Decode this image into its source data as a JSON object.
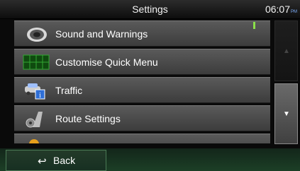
{
  "header": {
    "title": "Settings",
    "time": "06:07",
    "ampm": "PM"
  },
  "menu": {
    "items": [
      {
        "label": "Sound and Warnings",
        "icon": "speaker-icon"
      },
      {
        "label": "Customise Quick Menu",
        "icon": "grid-icon"
      },
      {
        "label": "Traffic",
        "icon": "traffic-info-icon"
      },
      {
        "label": "Route Settings",
        "icon": "route-settings-icon"
      }
    ]
  },
  "scroll": {
    "up": "▲",
    "down": "▼"
  },
  "footer": {
    "back_label": "Back",
    "back_icon": "↩"
  },
  "colors": {
    "accent": "#8be04a",
    "item_bg": "#4a4a4a",
    "footer_bg": "#1c3f26"
  }
}
